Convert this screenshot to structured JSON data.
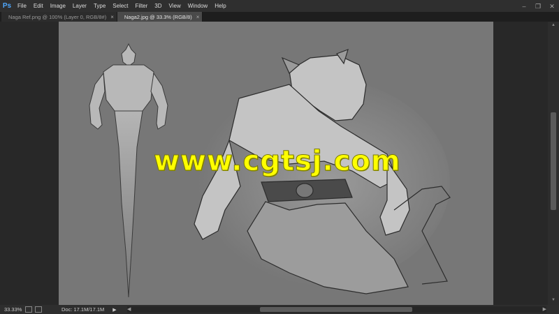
{
  "app": {
    "logo": "Ps"
  },
  "menu": [
    "File",
    "Edit",
    "Image",
    "Layer",
    "Type",
    "Select",
    "Filter",
    "3D",
    "View",
    "Window",
    "Help"
  ],
  "tabs": [
    {
      "label": "Naga Ref.png @ 100% (Layer 0, RGB/8#)",
      "active": false
    },
    {
      "label": "Naga2.jpg @ 33.3% (RGB/8)",
      "active": true
    }
  ],
  "canvas": {
    "watermark": "www.cgtsj.com"
  },
  "status": {
    "zoom": "33.33%",
    "doc": "Doc: 17.1M/17.1M"
  },
  "colors": {
    "accent": "#4fa8ff",
    "watermark": "#ffff00",
    "canvas_bg": "#777777"
  }
}
